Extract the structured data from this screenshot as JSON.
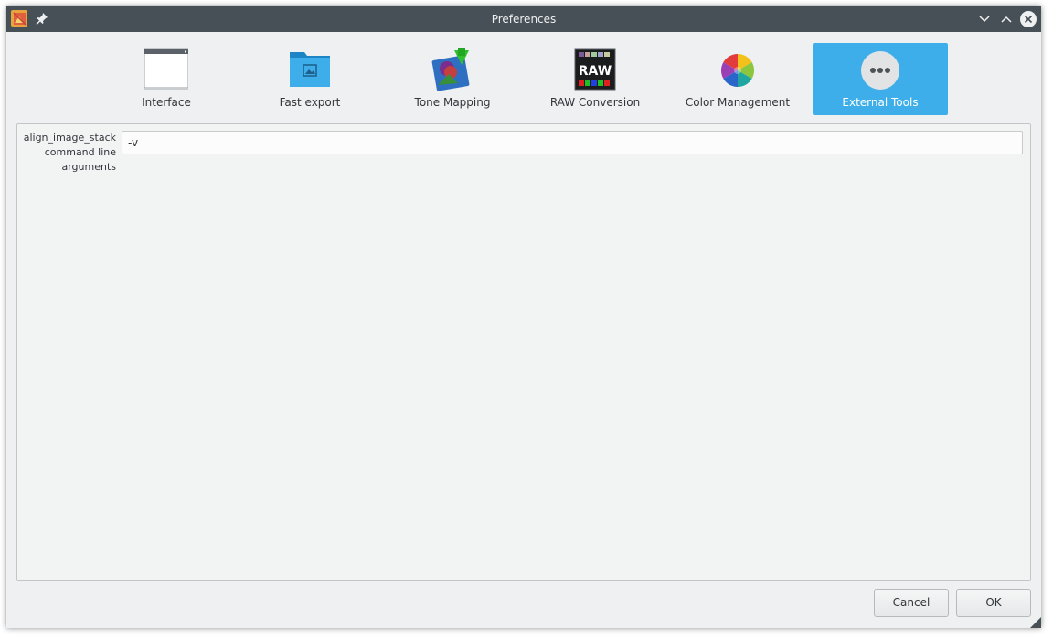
{
  "window": {
    "title": "Preferences"
  },
  "pages": [
    {
      "label": "Interface",
      "icon": "window-icon",
      "selected": false
    },
    {
      "label": "Fast export",
      "icon": "folder-image-icon",
      "selected": false
    },
    {
      "label": "Tone Mapping",
      "icon": "tone-mapping-icon",
      "selected": false
    },
    {
      "label": "RAW Conversion",
      "icon": "raw-icon",
      "selected": false
    },
    {
      "label": "Color Management",
      "icon": "color-wheel-icon",
      "selected": false
    },
    {
      "label": "External Tools",
      "icon": "more-dots-icon",
      "selected": true
    }
  ],
  "raw_icon_text": "RAW",
  "external_tools": {
    "align_label": "align_image_stack command line arguments",
    "align_value": "-v"
  },
  "buttons": {
    "cancel": "Cancel",
    "ok": "OK"
  },
  "colors": {
    "titlebar": "#475057",
    "accent": "#3daee9",
    "window_bg": "#eff0f1"
  }
}
